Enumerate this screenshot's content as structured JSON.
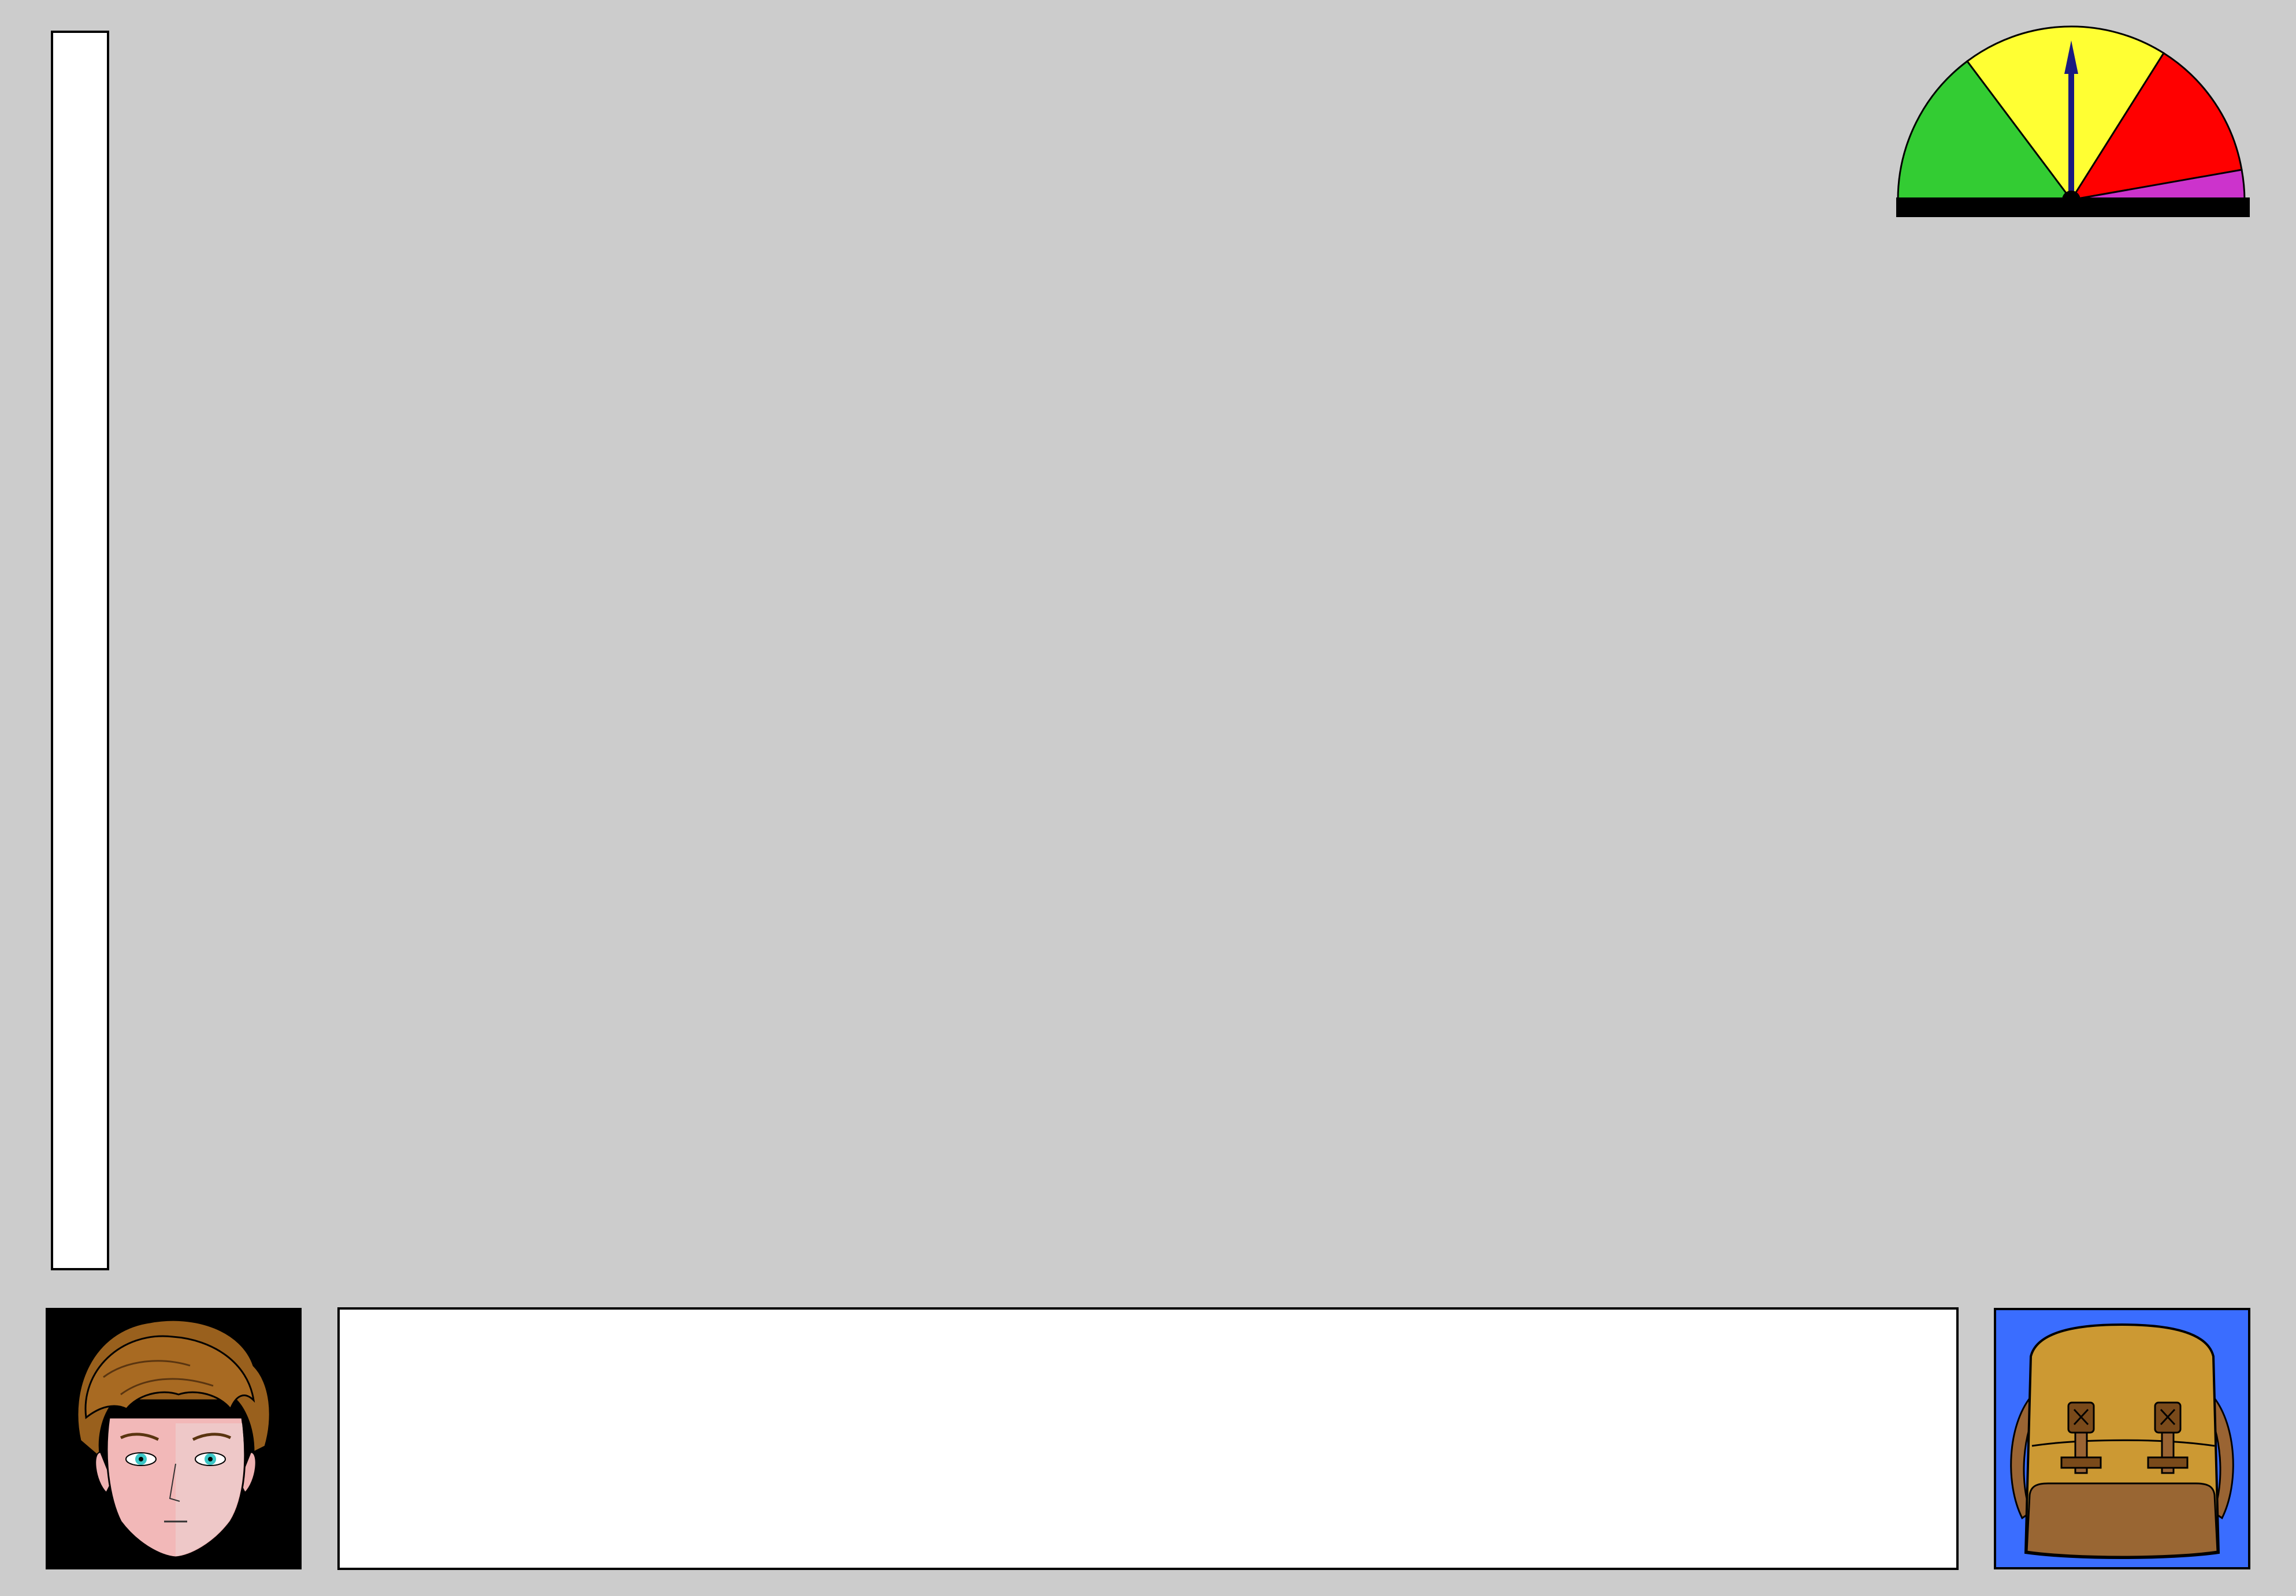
{
  "hud": {
    "side_panel_text": "",
    "message_text": "",
    "gauge": {
      "level": 0.5,
      "zones": [
        {
          "name": "green",
          "color": "#33cc33"
        },
        {
          "name": "yellow",
          "color": "#ffff33"
        },
        {
          "name": "red",
          "color": "#ff0000"
        },
        {
          "name": "magenta",
          "color": "#cc33cc"
        }
      ],
      "needle_color": "#1a1a80"
    },
    "avatar": {
      "icon": "character-portrait-icon",
      "background": "#000000"
    },
    "inventory": {
      "icon": "backpack-icon",
      "background": "#3a6dff"
    }
  }
}
